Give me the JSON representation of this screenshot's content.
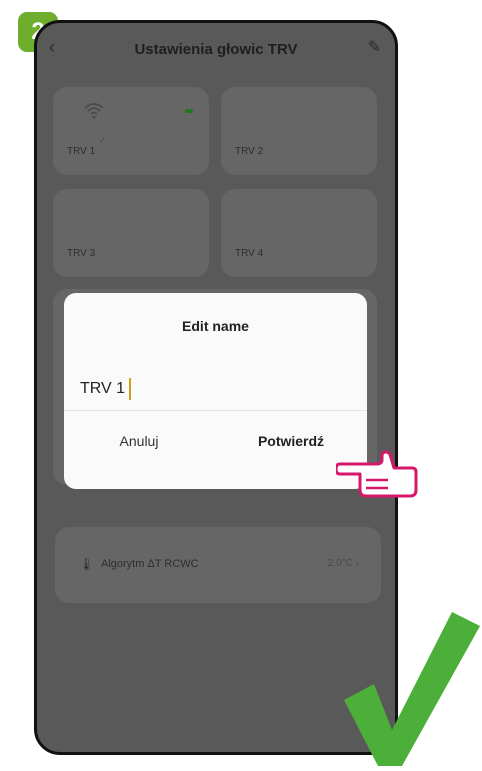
{
  "step_badge": "2",
  "header": {
    "title": "Ustawienia głowic TRV",
    "back_icon": "chevron-left-icon",
    "edit_icon": "pencil-icon"
  },
  "tiles": [
    {
      "label": "TRV 1",
      "has_wifi": true,
      "status_color": "#1e7a1e"
    },
    {
      "label": "TRV 2"
    },
    {
      "label": "TRV 3"
    },
    {
      "label": "TRV 4"
    }
  ],
  "settings_row": {
    "label": "Algorytm ΔT RCWC",
    "value": "2.0°C ›"
  },
  "dialog": {
    "title": "Edit name",
    "input_value": "TRV 1",
    "cancel_label": "Anuluj",
    "confirm_label": "Potwierdź"
  },
  "colors": {
    "accent_green": "#4caf3a",
    "badge_green": "#6fae2d",
    "hand_pink": "#d6186a"
  }
}
